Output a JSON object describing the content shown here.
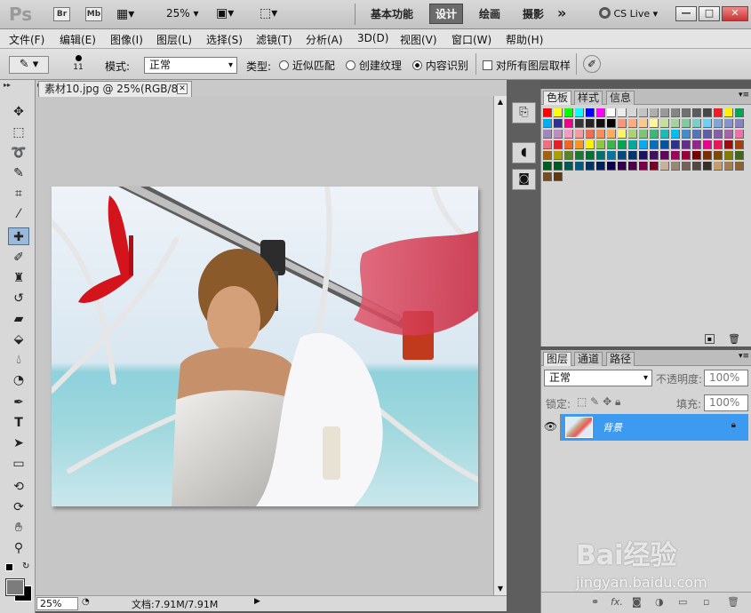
{
  "appbar": {
    "logo": "Ps",
    "bridge_label": "Br",
    "minibridge_label": "Mb",
    "zoom": "25%",
    "workspaces": [
      "基本功能",
      "设计",
      "绘画",
      "摄影"
    ],
    "active_workspace": "设计",
    "more": "»",
    "cslive": "CS Live",
    "win_min": "—",
    "win_max": "□",
    "win_close": "✕"
  },
  "menubar": {
    "items": [
      "文件(F)",
      "编辑(E)",
      "图像(I)",
      "图层(L)",
      "选择(S)",
      "滤镜(T)",
      "分析(A)",
      "3D(D)",
      "视图(V)",
      "窗口(W)",
      "帮助(H)"
    ]
  },
  "options": {
    "brush_size": "11",
    "mode_label": "模式:",
    "mode_value": "正常",
    "type_label": "类型:",
    "radio_proximity": "近似匹配",
    "radio_texture": "创建纹理",
    "radio_content": "内容识别",
    "radio_selected": "内容识别",
    "sample_all": "对所有图层取样"
  },
  "document": {
    "tab_title": "素材10.jpg @ 25%(RGB/8)",
    "tab_close": "✕",
    "status_zoom": "25%",
    "status_doc": "文档:7.91M/7.91M"
  },
  "swatches": {
    "tabs": [
      "色板",
      "样式",
      "信息"
    ],
    "active_tab": "色板",
    "colors": [
      "#ff0000",
      "#ffff00",
      "#00ff00",
      "#00ffff",
      "#0000ff",
      "#ff00ff",
      "#ffffff",
      "#ebebeb",
      "#d6d6d6",
      "#c2c2c2",
      "#adadad",
      "#999999",
      "#858585",
      "#707070",
      "#5c5c5c",
      "#474747",
      "#ee1d24",
      "#fff200",
      "#00a651",
      "#00aeef",
      "#2e3192",
      "#ec008c",
      "#363636",
      "#242424",
      "#121212",
      "#000000",
      "#f7977a",
      "#f9ad81",
      "#fdc68a",
      "#fff79a",
      "#c4df9b",
      "#a3d39c",
      "#82ca9d",
      "#7bcdc8",
      "#6ecff6",
      "#7ea7d8",
      "#8493ca",
      "#8882be",
      "#a187be",
      "#bc8dbf",
      "#f49ac2",
      "#f6989d",
      "#f26c4f",
      "#f68e55",
      "#fbaf5c",
      "#fff467",
      "#acd372",
      "#7cc576",
      "#3bb878",
      "#1abbb4",
      "#00bff3",
      "#438ccb",
      "#5574b9",
      "#605ca8",
      "#855fa8",
      "#a763a8",
      "#f06eaa",
      "#f26d7d",
      "#ed1c24",
      "#f26522",
      "#f7941d",
      "#fff200",
      "#8dc63f",
      "#39b54a",
      "#00a651",
      "#00a99d",
      "#00aeef",
      "#0072bc",
      "#0054a6",
      "#2e3192",
      "#662d91",
      "#92278f",
      "#ec008c",
      "#ed145b",
      "#9e0b0f",
      "#a0410d",
      "#a3620a",
      "#aba000",
      "#598527",
      "#1a7b30",
      "#007236",
      "#00746b",
      "#0076a3",
      "#004b80",
      "#003471",
      "#1b1464",
      "#440e62",
      "#630460",
      "#9e005d",
      "#9e0039",
      "#790000",
      "#7b2e00",
      "#7d4900",
      "#827b00",
      "#406618",
      "#005e20",
      "#005826",
      "#005952",
      "#005b7f",
      "#003663",
      "#002157",
      "#0d004c",
      "#32004b",
      "#4b0049",
      "#7b0046",
      "#7a0026",
      "#c7b299",
      "#998675",
      "#736357",
      "#534741",
      "#37302a",
      "#c69c6d",
      "#a67c52",
      "#8c6239",
      "#754c24",
      "#603913"
    ]
  },
  "layers": {
    "tabs": [
      "图层",
      "通道",
      "路径"
    ],
    "active_tab": "图层",
    "blend_mode": "正常",
    "opacity_label": "不透明度:",
    "opacity_value": "100%",
    "lock_label": "锁定:",
    "fill_label": "填充:",
    "fill_value": "100%",
    "layer_name": "背景"
  },
  "watermark": {
    "brand": "Bai经验",
    "url": "jingyan.baidu.com"
  }
}
